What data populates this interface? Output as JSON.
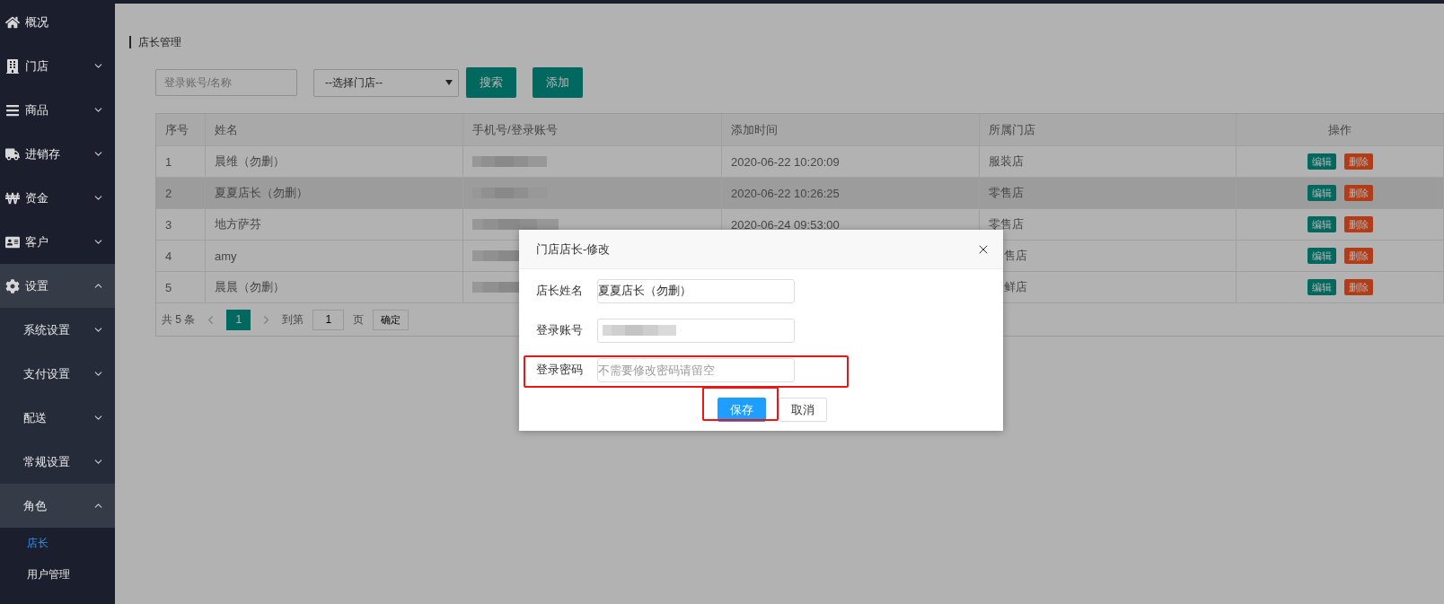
{
  "sidebar": {
    "items": [
      {
        "label": "概况"
      },
      {
        "label": "门店",
        "expanded": false
      },
      {
        "label": "商品",
        "expanded": false
      },
      {
        "label": "进销存",
        "expanded": false
      },
      {
        "label": "资金",
        "expanded": false
      },
      {
        "label": "客户",
        "expanded": false
      },
      {
        "label": "设置",
        "expanded": true,
        "children": [
          {
            "label": "系统设置",
            "expanded": false
          },
          {
            "label": "支付设置",
            "expanded": false
          },
          {
            "label": "配送",
            "expanded": false
          },
          {
            "label": "常规设置",
            "expanded": false
          },
          {
            "label": "角色",
            "expanded": true,
            "children": [
              {
                "label": "店长",
                "selected": true
              },
              {
                "label": "用户管理",
                "selected": false
              }
            ]
          }
        ]
      }
    ]
  },
  "page_title": "店长管理",
  "toolbar": {
    "search_placeholder": "登录账号/名称",
    "store_select": "--选择门店--",
    "buttons": [
      "搜索",
      "添加"
    ]
  },
  "table": {
    "columns": [
      "序号",
      "姓名",
      "手机号/登录账号",
      "添加时间",
      "所属门店",
      "操作"
    ],
    "rows": [
      {
        "selected": false,
        "index": "1",
        "name": "晨维（勿删）",
        "time": "2020-06-22 10:20:09",
        "store": "服装店",
        "actions": [
          "编辑",
          "删除"
        ]
      },
      {
        "selected": true,
        "index": "2",
        "name": "夏夏店长（勿删）",
        "time": "2020-06-22 10:26:25",
        "store": "零售店",
        "actions": [
          "编辑",
          "删除"
        ]
      },
      {
        "selected": false,
        "index": "3",
        "name": "地方萨芬",
        "time": "2020-06-24 09:53:00",
        "store": "零售店",
        "actions": [
          "编辑",
          "删除"
        ]
      },
      {
        "selected": false,
        "index": "4",
        "name": "amy",
        "store": "售店",
        "partly_hidden": true,
        "actions": [
          "编辑",
          "删除"
        ]
      },
      {
        "selected": false,
        "index": "5",
        "name": "晨晨（勿删）",
        "store": "鲜店",
        "partly_hidden": true,
        "actions": [
          "编辑",
          "删除"
        ]
      }
    ]
  },
  "pagination": {
    "total": "共 5 条",
    "pages": [
      {
        "label": "1",
        "selected": true
      }
    ],
    "goto_label": "到第",
    "goto_value": "1",
    "page_unit": "页",
    "confirm": "确定"
  },
  "dialog": {
    "title": "门店店长-修改",
    "fields": [
      {
        "label": "店长姓名",
        "value": "夏夏店长（勿删）"
      },
      {
        "label": "登录账号",
        "blurred": true
      },
      {
        "label": "登录密码",
        "placeholder": "不需要修改密码请留空",
        "highlighted": true
      }
    ],
    "buttons": [
      {
        "label": "保存",
        "kind": "primary",
        "highlighted": true
      },
      {
        "label": "取消",
        "kind": "default",
        "highlighted": false
      }
    ]
  }
}
